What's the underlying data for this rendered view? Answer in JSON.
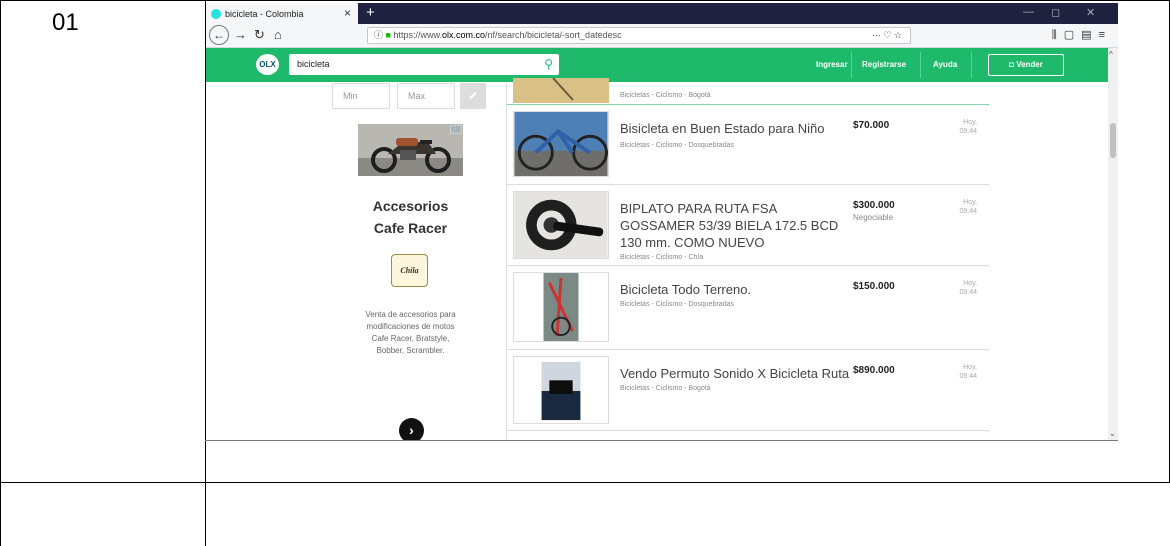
{
  "row_number": "01",
  "browser": {
    "tab_title": "bicicleta - Colombia",
    "tab_close": "×",
    "new_tab": "+",
    "url_prefix": "https://www.",
    "url_domain": "olx.com.co",
    "url_path": "/nf/search/bicicleta/-sort_datedesc",
    "url_right": "··· ♡ ☆"
  },
  "olx": {
    "logo": "OLX",
    "search_value": "bicicleta",
    "nav": [
      "Ingresar",
      "Registrarse",
      "Ayuda"
    ],
    "vender_label": "Vender"
  },
  "filter": {
    "min_placeholder": "Min",
    "max_placeholder": "Max"
  },
  "ad": {
    "title_line1": "Accesorios",
    "title_line2": "Cafe Racer",
    "logo_text": "Chila",
    "description": "Venta de accesorios para modificaciones de motos Cafe Racer, Bratstyle, Bobber, Scrambler.",
    "arrow": "›"
  },
  "listings": [
    {
      "title": "",
      "category": "Bicicletas - Ciclismo - Bogotá",
      "price": "",
      "date_line1": "",
      "date_line2": ""
    },
    {
      "title": "Bisicleta en Buen Estado para Niño",
      "category": "Bicicletas - Ciclismo - Dosquebradas",
      "price": "$70.000",
      "date_line1": "Hoy,",
      "date_line2": "09:44"
    },
    {
      "title": "BIPLATO PARA RUTA FSA GOSSAMER 53/39 BIELA 172.5 BCD 130 mm. COMO NUEVO",
      "category": "Bicicletas - Ciclismo - Chía",
      "price": "$300.000",
      "negotiable": "Negociable",
      "date_line1": "Hoy,",
      "date_line2": "09:44"
    },
    {
      "title": "Bicicleta Todo Terreno.",
      "category": "Bicicletas - Ciclismo - Dosquebradas",
      "price": "$150.000",
      "date_line1": "Hoy,",
      "date_line2": "09:44"
    },
    {
      "title": "Vendo Permuto Sonido X Bicicleta Ruta",
      "category": "Bicicletas - Ciclismo - Bogotá",
      "price": "$890.000",
      "date_line1": "Hoy,",
      "date_line2": "09:44"
    }
  ],
  "colors": {
    "olx_green": "#1fb96b",
    "tabbar": "#202340"
  }
}
